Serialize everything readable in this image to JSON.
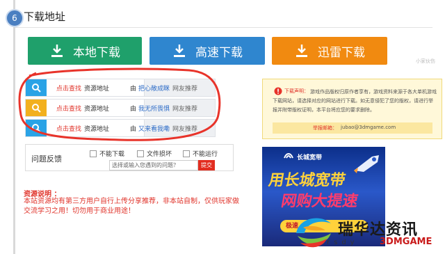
{
  "section": {
    "step": "6",
    "title": "下载地址"
  },
  "buttons": [
    {
      "label": "本地下载",
      "color": "#1fa06b"
    },
    {
      "label": "高速下载",
      "color": "#2f86cf"
    },
    {
      "label": "迅雷下载",
      "color": "#f18a10"
    }
  ],
  "watermark_small": "小家伙伤",
  "resource_rows": [
    {
      "icon_color": "#2aa3e6",
      "click": "点击查找",
      "addr": "资源地址",
      "by": "由",
      "user": "把心敞成眯",
      "rec": "网友推荐"
    },
    {
      "icon_color": "#f2b01e",
      "click": "点击查找",
      "addr": "资源地址",
      "by": "由",
      "user": "我无所畏惧",
      "rec": "网友推荐"
    },
    {
      "icon_color": "#2aa3e6",
      "click": "点击查找",
      "addr": "资源地址",
      "by": "由",
      "user": "又来看我嘞",
      "rec": "网友推荐"
    }
  ],
  "feedback": {
    "label": "问题反馈",
    "options": [
      "不能下载",
      "文件损坏",
      "不能运行"
    ],
    "placeholder": "选择或输入您遇到的问题？",
    "submit": "提交"
  },
  "resource_note": {
    "title": "资源说明 ：",
    "text": "本站资源均有第三方用户自行上传分享推荐，非本站自制，仅供玩家做交流学习之用！切勿用于商业用途！"
  },
  "notice": {
    "label": "下载声明：",
    "body": "游戏作品版权归原作者享有，游戏资料来源于各大单机游戏下载网站，请选择对应的网站进行下载。如无意侵犯了您的版权，请进行举报并附带版权证明，本平台将应您的要求删除。",
    "mail_label": "举报邮箱：",
    "mail": "jubao@3dmgame.com"
  },
  "ad": {
    "brand": "长城宽带",
    "line1": "用长城宽带",
    "line2": "网购大提速",
    "pill": "极速"
  },
  "site": {
    "name": "瑞华达资讯",
    "url": "rsdy",
    "brand3dm": "3DMGAME"
  }
}
